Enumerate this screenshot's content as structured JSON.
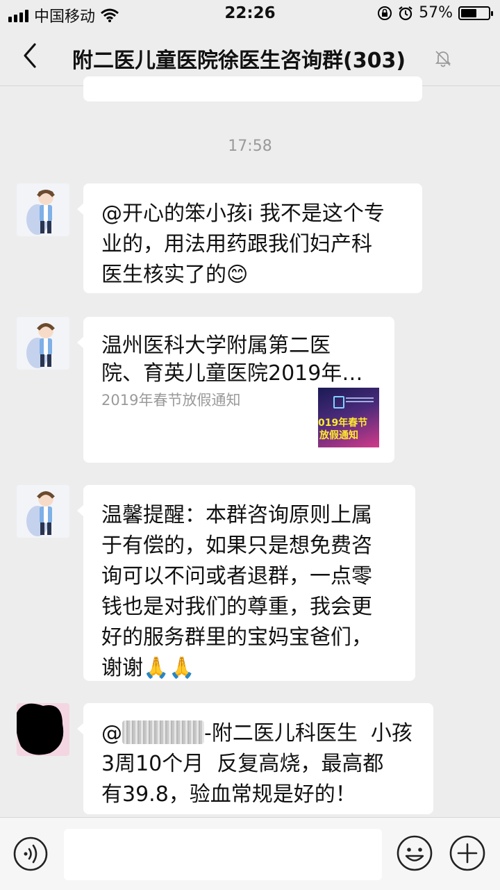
{
  "status_bar": {
    "carrier": "中国移动",
    "time": "22:26",
    "battery": "57%",
    "battery_level": 0.57
  },
  "header": {
    "title": "附二医儿童医院徐医生咨询群(303)"
  },
  "timestamp": "17:58",
  "messages": [
    {
      "type": "text",
      "text": "@开心的笨小孩i 我不是这个专\n业的，用法用药跟我们妇产科\n医生核实了的😊"
    },
    {
      "type": "link",
      "title": "温州医科大学附属第二医\n院、育英儿童医院2019年…",
      "description": "2019年春节放假通知",
      "thumb_line1": "019年春节",
      "thumb_line2": "放假通知"
    },
    {
      "type": "text",
      "text": "温馨提醒：本群咨询原则上属\n于有偿的，如果只是想免费咨\n询可以不问或者退群，一点零\n钱也是对我们的尊重，我会更\n好的服务群里的宝妈宝爸们，\n谢谢🙏🙏"
    },
    {
      "type": "text",
      "prefix": "@",
      "text_line1_rest": "-附二医儿科医生  小孩",
      "text_rest": "3周10个月  反复高烧，最高都\n有39.8，验血常规是好的！"
    }
  ],
  "icons": {
    "back": "chevron-left-icon",
    "mute": "bell-muted-icon",
    "voice": "voice-icon",
    "emoji": "emoji-icon",
    "plus": "plus-icon"
  }
}
